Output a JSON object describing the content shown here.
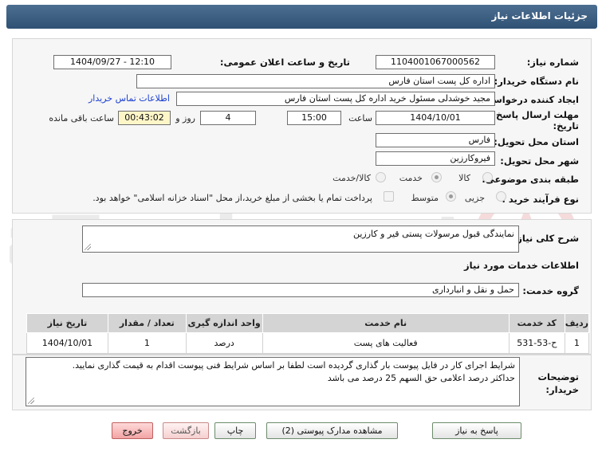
{
  "window": {
    "title": "جزئیات اطلاعات نیاز"
  },
  "form": {
    "need_number_label": "شماره نیاز:",
    "need_number": "1104001067000562",
    "announce_label": "تاریخ و ساعت اعلان عمومی:",
    "announce_value": "1404/09/27 - 12:10",
    "buyer_org_label": "نام دستگاه خریدار:",
    "buyer_org": "اداره کل پست استان فارس",
    "creator_label": "ایجاد کننده درخواست:",
    "creator": "مجید خوشدلی مسئول خرید اداره کل پست استان فارس",
    "contact_link": "اطلاعات تماس خریدار",
    "deadline_label_1": "مهلت ارسال پاسخ: تا",
    "deadline_label_2": "تاریخ:",
    "deadline_date": "1404/10/01",
    "time_label": "ساعت",
    "deadline_time": "15:00",
    "days_value": "4",
    "days_label": "روز و",
    "remaining_value": "00:43:02",
    "remaining_label": "ساعت باقی مانده",
    "province_label": "استان محل تحویل:",
    "province": "فارس",
    "city_label": "شهر محل تحویل:",
    "city": "فیروکارزین",
    "category_label": "طبقه بندی موضوعی:",
    "category_options": [
      "کالا",
      "خدمت",
      "کالا/خدمت"
    ],
    "category_selected": "خدمت",
    "process_label": "نوع فرآیند خرید :",
    "process_options": [
      "جزیی",
      "متوسط"
    ],
    "process_selected": "متوسط",
    "payment_note": "پرداخت تمام یا بخشی از مبلغ خرید،از محل \"اسناد خزانه اسلامی\" خواهد بود."
  },
  "summary": {
    "label": "شرح کلی نیاز:",
    "text": "نمایندگی قبول مرسولات پستی  قیر و کارزین"
  },
  "services": {
    "section_title": "اطلاعات خدمات مورد نیاز",
    "group_label": "گروه خدمت:",
    "group_value": "حمل و نقل و انبارداری",
    "columns": [
      "ردیف",
      "کد خدمت",
      "نام خدمت",
      "واحد اندازه گیری",
      "تعداد / مقدار",
      "تاریخ نیاز"
    ],
    "rows": [
      {
        "index": "1",
        "code": "ح-53-531",
        "name": "فعالیت های پست",
        "unit": "درصد",
        "qty": "1",
        "date": "1404/10/01"
      }
    ]
  },
  "buyer_notes": {
    "label_1": "توضیحات",
    "label_2": "خریدار:",
    "line1": "شرایط اجرای کار در فایل پیوست بار گذاری گردیده است لطفا بر اساس شرایط فنی پیوست اقدام به قیمت گذاری نمایید.",
    "line2": "حداکثر درصد اعلامی حق السهم 25 درصد می باشد"
  },
  "buttons": {
    "reply": "پاسخ به نیاز",
    "attachments": "مشاهده مدارک پیوستی (2)",
    "print": "چاپ",
    "back": "بازگشت",
    "exit": "خروج"
  },
  "watermark": {
    "text": "AriaTender.net"
  },
  "colors": {
    "title_bar": "#3b5d80",
    "link": "#1a3fd0",
    "highlight": "#fff6c8",
    "exit_button": "#f2a4a4"
  }
}
